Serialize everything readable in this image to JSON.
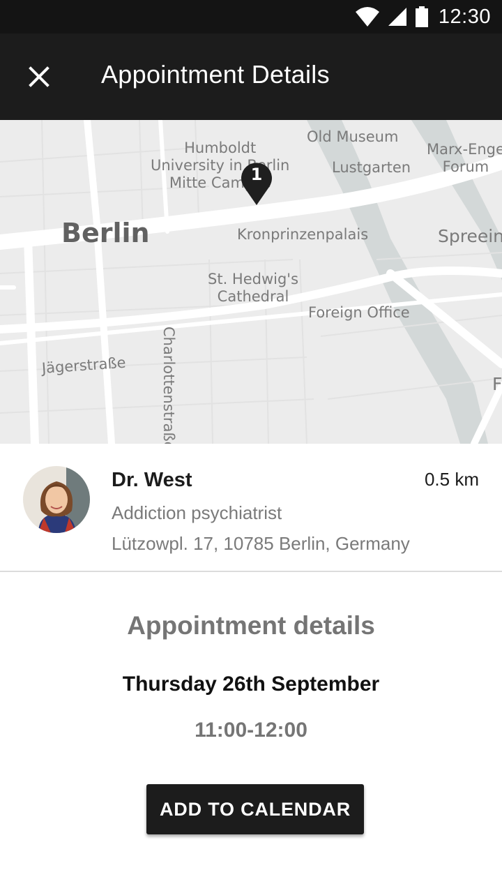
{
  "status_bar": {
    "time": "12:30",
    "icons": [
      "wifi-icon",
      "cellular-signal-icon",
      "battery-icon"
    ]
  },
  "app_bar": {
    "title": "Appointment Details",
    "close_icon": "close-icon"
  },
  "map": {
    "labels": {
      "humboldt": "Humboldt\nUniversity in Berlin\nMitte Campus",
      "old_museum": "Old Museum",
      "lustgarten": "Lustgarten",
      "marx_engels": "Marx-Enge\nForum",
      "berlin": "Berlin",
      "kronprinzenpalais": "Kronprinzenpalais",
      "spreein": "Spreein",
      "st_hedwigs": "St. Hedwig's\nCathedral",
      "foreign_office": "Foreign Office",
      "jaegerstrasse": "Jägerstraße",
      "charlottenstrasse": "Charlottenstraße",
      "f": "F"
    },
    "pin_number": "1"
  },
  "doctor": {
    "name": "Dr. West",
    "distance": "0.5 km",
    "specialty": "Addiction psychiatrist",
    "address": "Lützowpl. 17, 10785 Berlin, Germany"
  },
  "appointment": {
    "section_title": "Appointment details",
    "date": "Thursday 26th September",
    "time": "11:00-12:00",
    "add_to_calendar_label": "ADD TO CALENDAR"
  },
  "colors": {
    "app_bar": "#1c1c1c",
    "status_bar": "#141414",
    "map_background": "#ececec",
    "secondary_text": "#7a7a7a",
    "button": "#1c1c1c"
  }
}
